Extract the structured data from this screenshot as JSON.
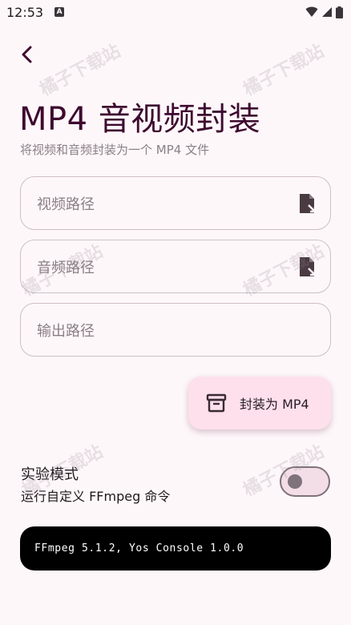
{
  "status_bar": {
    "time": "12:53",
    "notification": "A"
  },
  "header": {
    "title": "MP4 音视频封装",
    "subtitle": "将视频和音频封装为一个 MP4 文件"
  },
  "fields": {
    "video_path": {
      "placeholder": "视频路径"
    },
    "audio_path": {
      "placeholder": "音频路径"
    },
    "output_path": {
      "placeholder": "输出路径"
    }
  },
  "fab": {
    "label": "封装为 MP4",
    "icon": "archive-icon"
  },
  "experimental": {
    "title": "实验模式",
    "subtitle": "运行自定义 FFmpeg 命令",
    "enabled": false
  },
  "console": {
    "text": "FFmpeg 5.1.2, Yos Console 1.0.0"
  },
  "watermark": {
    "text": "橘子下载站"
  },
  "colors": {
    "background": "#fef7fa",
    "title": "#3d0a2f",
    "fab": "#fde0ec",
    "console": "#000000"
  }
}
